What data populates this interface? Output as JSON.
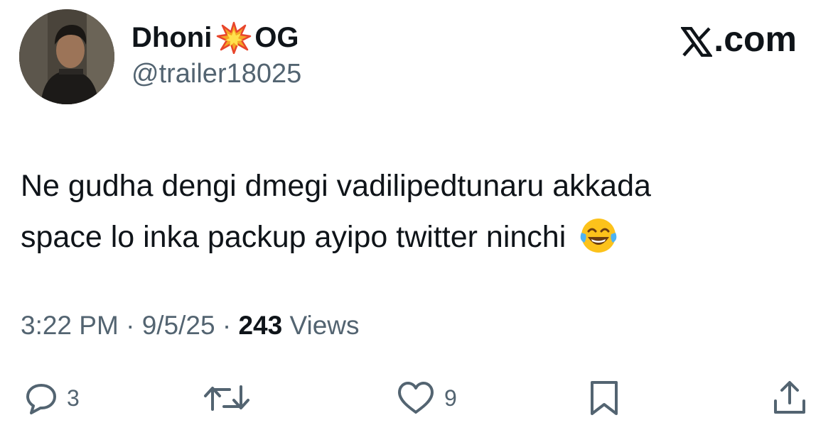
{
  "author": {
    "display_name_part1": "Dhoni",
    "display_name_emoji": "collision-emoji",
    "display_name_part2": "OG",
    "handle": "@trailer18025",
    "avatar": "profile-photo"
  },
  "brand": {
    "logo": "x-logo-icon",
    "text": ".com"
  },
  "tweet": {
    "line1": "Ne gudha dengi dmegi vadilipedtunaru akkada",
    "line2": "space lo inka packup ayipo twitter ninchi",
    "line2_emoji": "face-with-tears-of-joy-emoji"
  },
  "meta": {
    "time": "3:22 PM",
    "sep1": " · ",
    "date": "9/5/25",
    "sep2": " · ",
    "views_count": "243",
    "views_label": " Views"
  },
  "actions": {
    "reply": {
      "icon": "reply-icon",
      "count": "3"
    },
    "retweet": {
      "icon": "retweet-icon"
    },
    "like": {
      "icon": "heart-icon",
      "count": "9"
    },
    "bookmark": {
      "icon": "bookmark-icon"
    },
    "share": {
      "icon": "share-icon"
    }
  },
  "colors": {
    "text_primary": "#0f1419",
    "text_secondary": "#536471",
    "background": "#ffffff"
  }
}
